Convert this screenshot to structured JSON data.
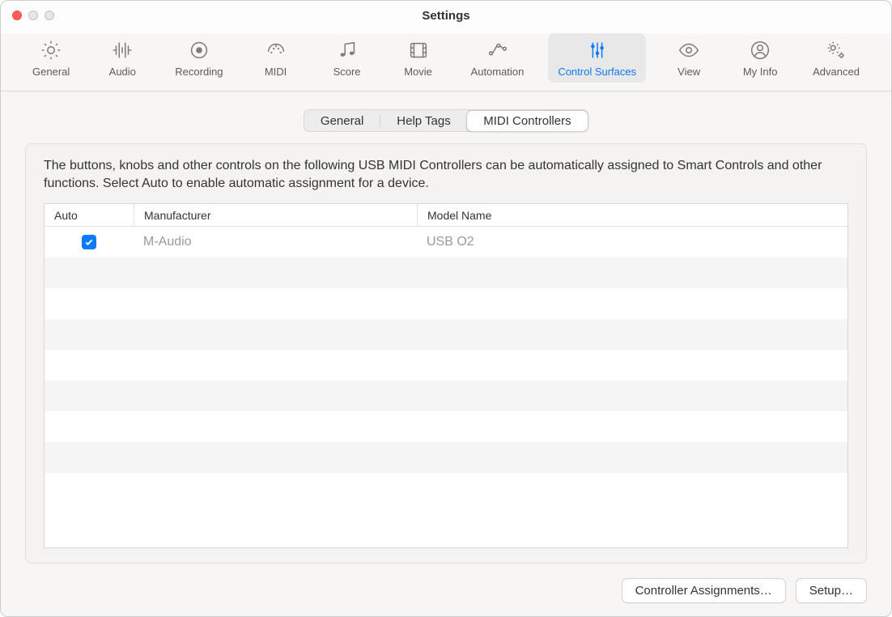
{
  "window": {
    "title": "Settings"
  },
  "toolbar": {
    "items": [
      {
        "key": "general",
        "label": "General"
      },
      {
        "key": "audio",
        "label": "Audio"
      },
      {
        "key": "recording",
        "label": "Recording"
      },
      {
        "key": "midi",
        "label": "MIDI"
      },
      {
        "key": "score",
        "label": "Score"
      },
      {
        "key": "movie",
        "label": "Movie"
      },
      {
        "key": "automation",
        "label": "Automation"
      },
      {
        "key": "control-surfaces",
        "label": "Control Surfaces"
      },
      {
        "key": "view",
        "label": "View"
      },
      {
        "key": "my-info",
        "label": "My Info"
      },
      {
        "key": "advanced",
        "label": "Advanced"
      }
    ],
    "active": "control-surfaces"
  },
  "tabs": {
    "items": [
      "General",
      "Help Tags",
      "MIDI Controllers"
    ],
    "active": 2
  },
  "description": "The buttons, knobs and other controls on the following USB MIDI Controllers can be automatically assigned to Smart Controls and other functions. Select Auto to enable automatic assignment for a device.",
  "table": {
    "columns": [
      "Auto",
      "Manufacturer",
      "Model Name"
    ],
    "rows": [
      {
        "auto": true,
        "manufacturer": "M-Audio",
        "model": "USB O2"
      }
    ],
    "empty_row_count": 7
  },
  "footer": {
    "controller_assignments": "Controller Assignments…",
    "setup": "Setup…"
  }
}
